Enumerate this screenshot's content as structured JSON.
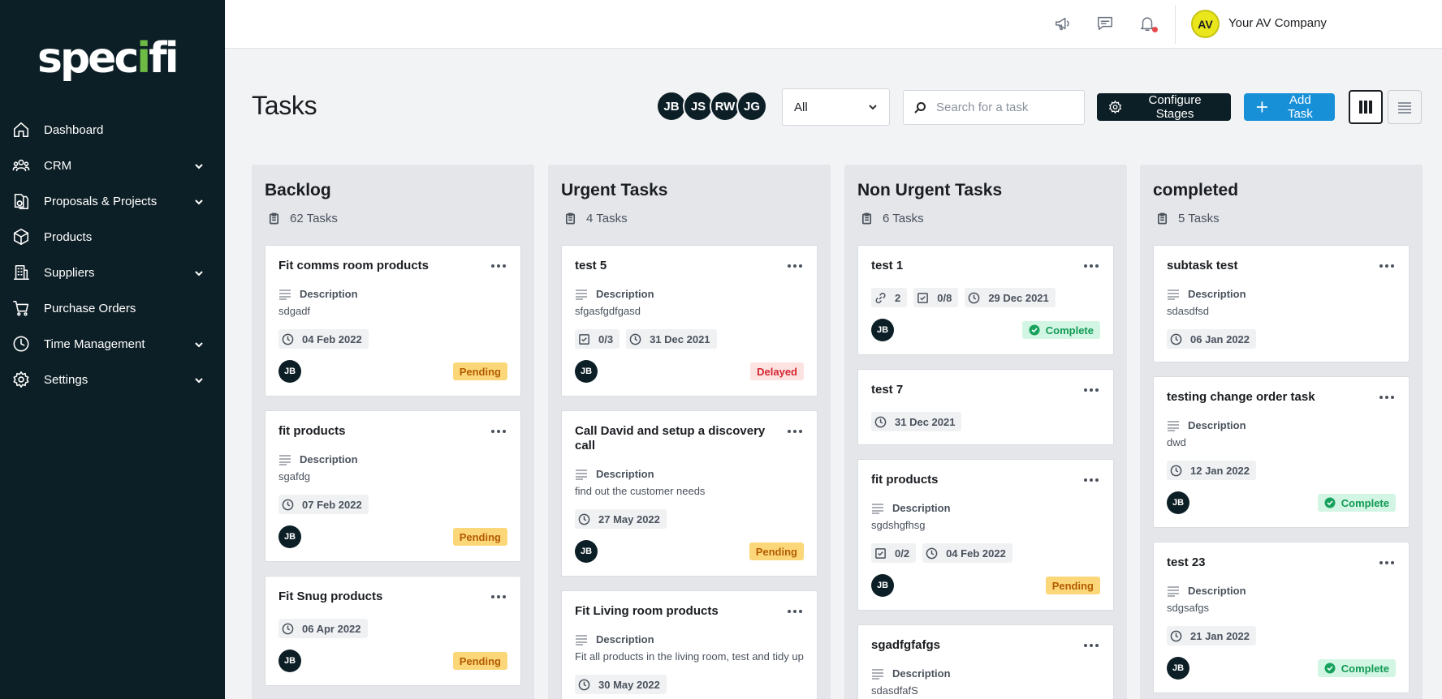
{
  "sidebar": {
    "logo": "specifi",
    "items": [
      {
        "label": "Dashboard",
        "icon": "home-icon",
        "expandable": false
      },
      {
        "label": "CRM",
        "icon": "users-icon",
        "expandable": true
      },
      {
        "label": "Proposals & Projects",
        "icon": "documents-icon",
        "expandable": true
      },
      {
        "label": "Products",
        "icon": "box-icon",
        "expandable": false
      },
      {
        "label": "Suppliers",
        "icon": "building-icon",
        "expandable": true
      },
      {
        "label": "Purchase Orders",
        "icon": "cart-icon",
        "expandable": false
      },
      {
        "label": "Time Management",
        "icon": "clock-icon",
        "expandable": true
      },
      {
        "label": "Settings",
        "icon": "gear-icon",
        "expandable": true
      }
    ]
  },
  "topbar": {
    "company_initials": "AV",
    "company_name": "Your AV Company"
  },
  "header": {
    "title": "Tasks",
    "assignees": [
      "JB",
      "JS",
      "RW",
      "JG"
    ],
    "filter_value": "All",
    "search_placeholder": "Search for a task",
    "configure_label": "Configure Stages",
    "add_label": "Add Task"
  },
  "columns": [
    {
      "title": "Backlog",
      "count": "62 Tasks",
      "cards": [
        {
          "title": "Fit comms room products",
          "desc_label": "Description",
          "desc": "sdgadf",
          "date": "04 Feb 2022",
          "avatar": "JB",
          "status": "Pending"
        },
        {
          "title": "fit products",
          "desc_label": "Description",
          "desc": "sgafdg",
          "date": "07 Feb 2022",
          "avatar": "JB",
          "status": "Pending"
        },
        {
          "title": "Fit Snug products",
          "date": "06 Apr 2022",
          "avatar": "JB",
          "status": "Pending"
        }
      ]
    },
    {
      "title": "Urgent Tasks",
      "count": "4 Tasks",
      "cards": [
        {
          "title": "test 5",
          "desc_label": "Description",
          "desc": "sfgasfgdfgasd",
          "checklist": "0/3",
          "date": "31 Dec 2021",
          "avatar": "JB",
          "status": "Delayed"
        },
        {
          "title": "Call David and setup a discovery call",
          "desc_label": "Description",
          "desc": "find out the customer needs",
          "date": "27 May 2022",
          "avatar": "JB",
          "status": "Pending"
        },
        {
          "title": "Fit Living room products",
          "desc_label": "Description",
          "desc": "Fit all products in the living room, test and tidy up",
          "date": "30 May 2022"
        }
      ]
    },
    {
      "title": "Non Urgent Tasks",
      "count": "6 Tasks",
      "cards": [
        {
          "title": "test 1",
          "links": "2",
          "checklist": "0/8",
          "date": "29 Dec 2021",
          "avatar": "JB",
          "status": "Complete"
        },
        {
          "title": "test 7",
          "date": "31 Dec 2021"
        },
        {
          "title": "fit products",
          "desc_label": "Description",
          "desc": "sgdshgfhsg",
          "checklist": "0/2",
          "date": "04 Feb 2022",
          "avatar": "JB",
          "status": "Pending"
        },
        {
          "title": "sgadfgfafgs",
          "desc_label": "Description",
          "desc": "sdasdfafS"
        }
      ]
    },
    {
      "title": "completed",
      "count": "5 Tasks",
      "cards": [
        {
          "title": "subtask test",
          "desc_label": "Description",
          "desc": "sdasdfsd",
          "date": "06 Jan 2022"
        },
        {
          "title": "testing change order task",
          "desc_label": "Description",
          "desc": "dwd",
          "date": "12 Jan 2022",
          "avatar": "JB",
          "status": "Complete"
        },
        {
          "title": "test 23",
          "desc_label": "Description",
          "desc": "sdgsafgs",
          "date": "21 Jan 2022",
          "avatar": "JB",
          "status": "Complete"
        }
      ]
    }
  ],
  "colors": {
    "sidebar_bg": "#0d1f26",
    "primary_blue": "#1890d8",
    "logo_accent": "#6dbb45",
    "pending_bg": "#fcd77a",
    "delayed_bg": "#fde2e2",
    "complete_bg": "#d3f5e3"
  }
}
